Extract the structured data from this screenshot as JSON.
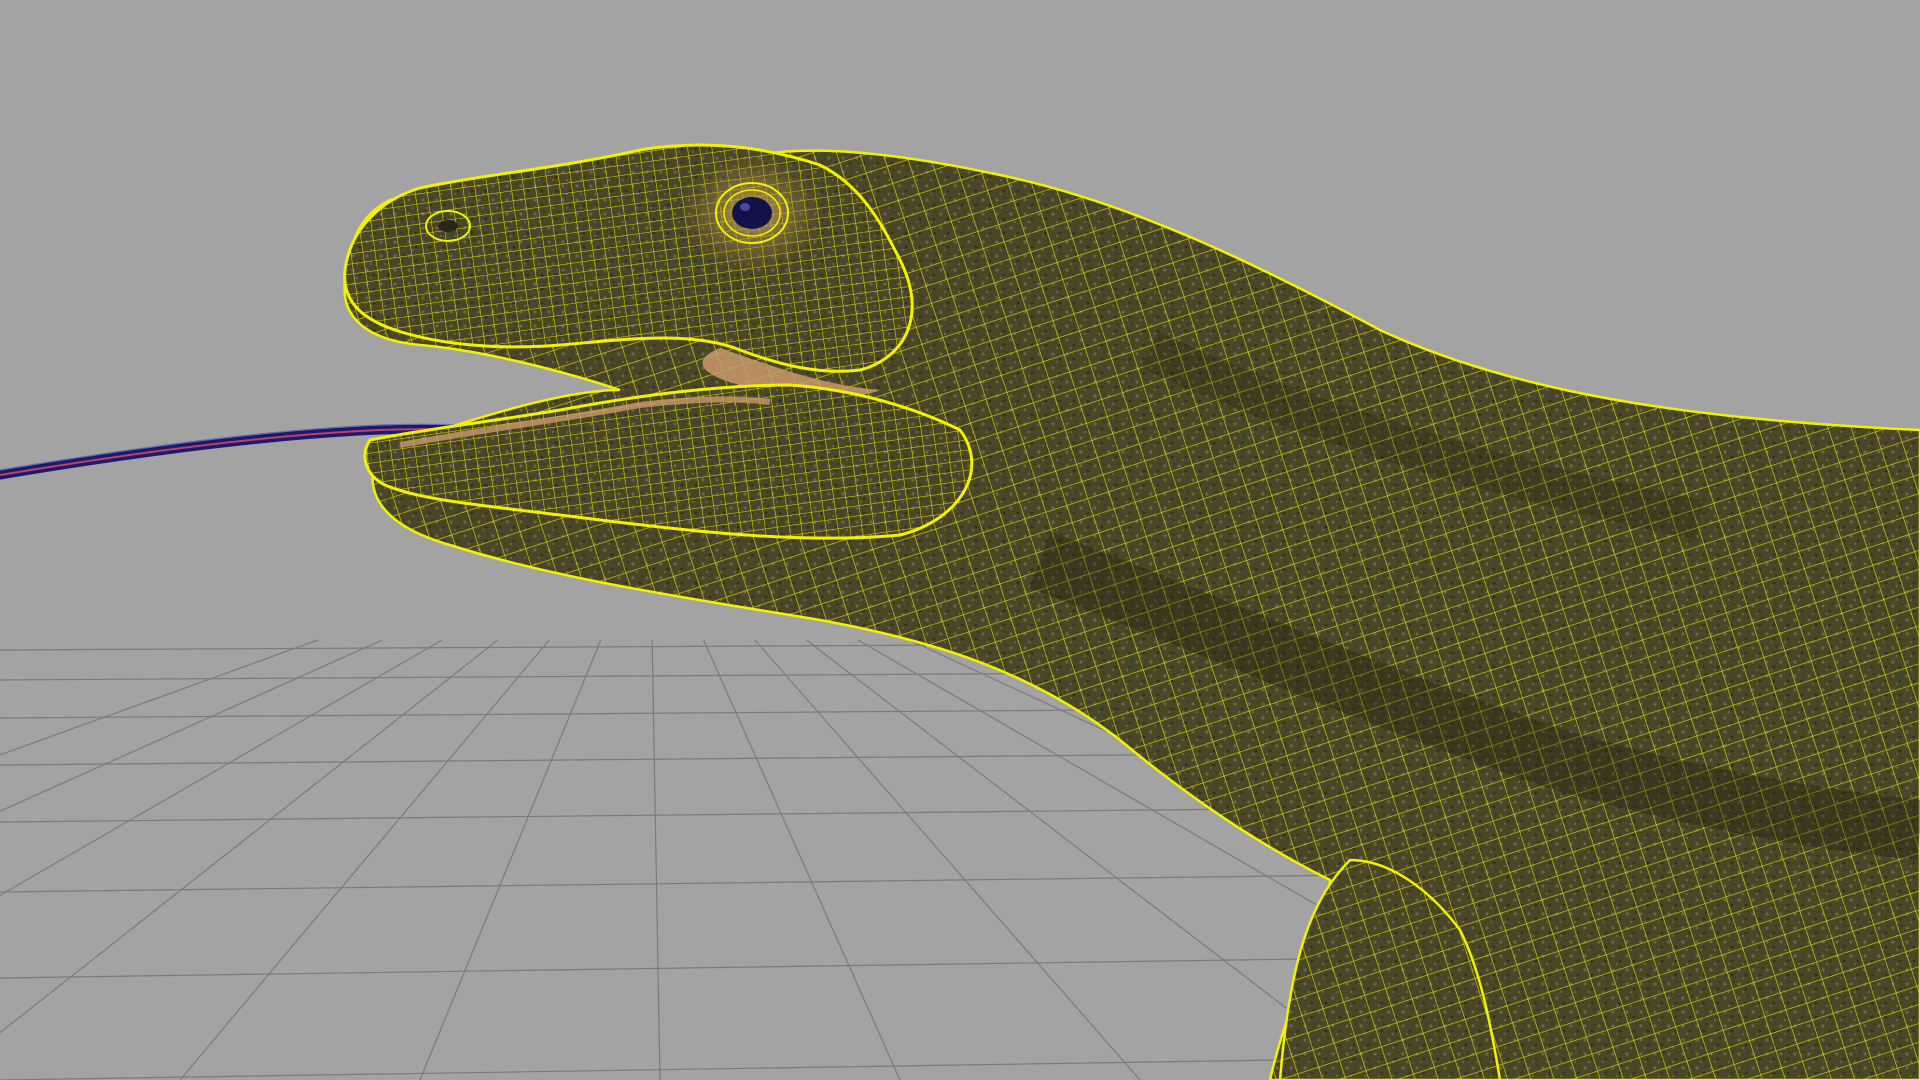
{
  "viewport": {
    "background_color": "#a3a3a3",
    "grid_color": "#8a8a8a",
    "grid_line_color": "#7b7b7b"
  },
  "model": {
    "subject": "lizard-head-and-neck",
    "wireframe_color": "#f2f200",
    "skin_base_color": "#4a4628",
    "skin_dark_color": "#2a2718",
    "skin_light_color": "#7a7350",
    "eye_ring_color": "#d9b25a",
    "eye_color": "#12124a",
    "mouth_color": "#c99a6a",
    "tongue_color": "#1a1a6e",
    "tongue_highlight_color": "#c04060"
  },
  "icons": {
    "eye": "eye-icon"
  }
}
